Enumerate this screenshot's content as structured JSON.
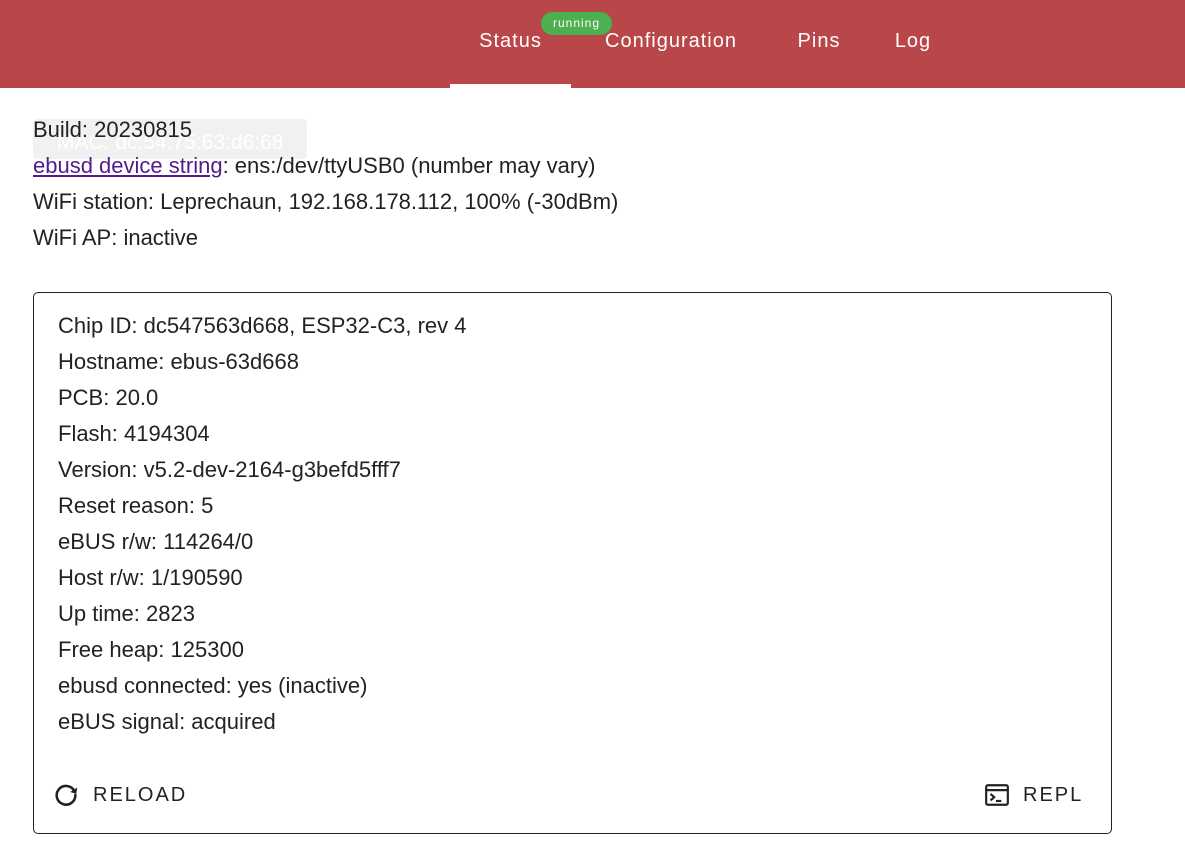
{
  "nav": {
    "tabs": [
      {
        "label": "Status"
      },
      {
        "label": "Configuration"
      },
      {
        "label": "Pins"
      },
      {
        "label": "Log"
      }
    ],
    "badge": "running"
  },
  "summary": {
    "mac": "MAC: dc:54:75:63:d6:68",
    "build": "Build: 20230815",
    "device_string_link": "ebusd device string",
    "device_string_value": ": ens:/dev/ttyUSB0 (number may vary)",
    "wifi_station": "WiFi station: Leprechaun, 192.168.178.112, 100% (-30dBm)",
    "wifi_ap": "WiFi AP: inactive"
  },
  "details": {
    "lines": [
      "Chip ID: dc547563d668, ESP32-C3, rev 4",
      "Hostname: ebus-63d668",
      "PCB: 20.0",
      "Flash: 4194304",
      "Version: v5.2-dev-2164-g3befd5fff7",
      "Reset reason: 5",
      "eBUS r/w: 114264/0",
      "Host r/w: 1/190590",
      "Up time: 2823",
      "Free heap: 125300",
      "ebusd connected: yes (inactive)",
      "eBUS signal: acquired"
    ],
    "reload_label": "RELOAD",
    "repl_label": "REPL"
  },
  "colors": {
    "header": "#b94648",
    "badge": "#4caf50",
    "link": "#551a8b"
  },
  "icons": {
    "reload": "reload-icon",
    "repl": "terminal-icon"
  }
}
